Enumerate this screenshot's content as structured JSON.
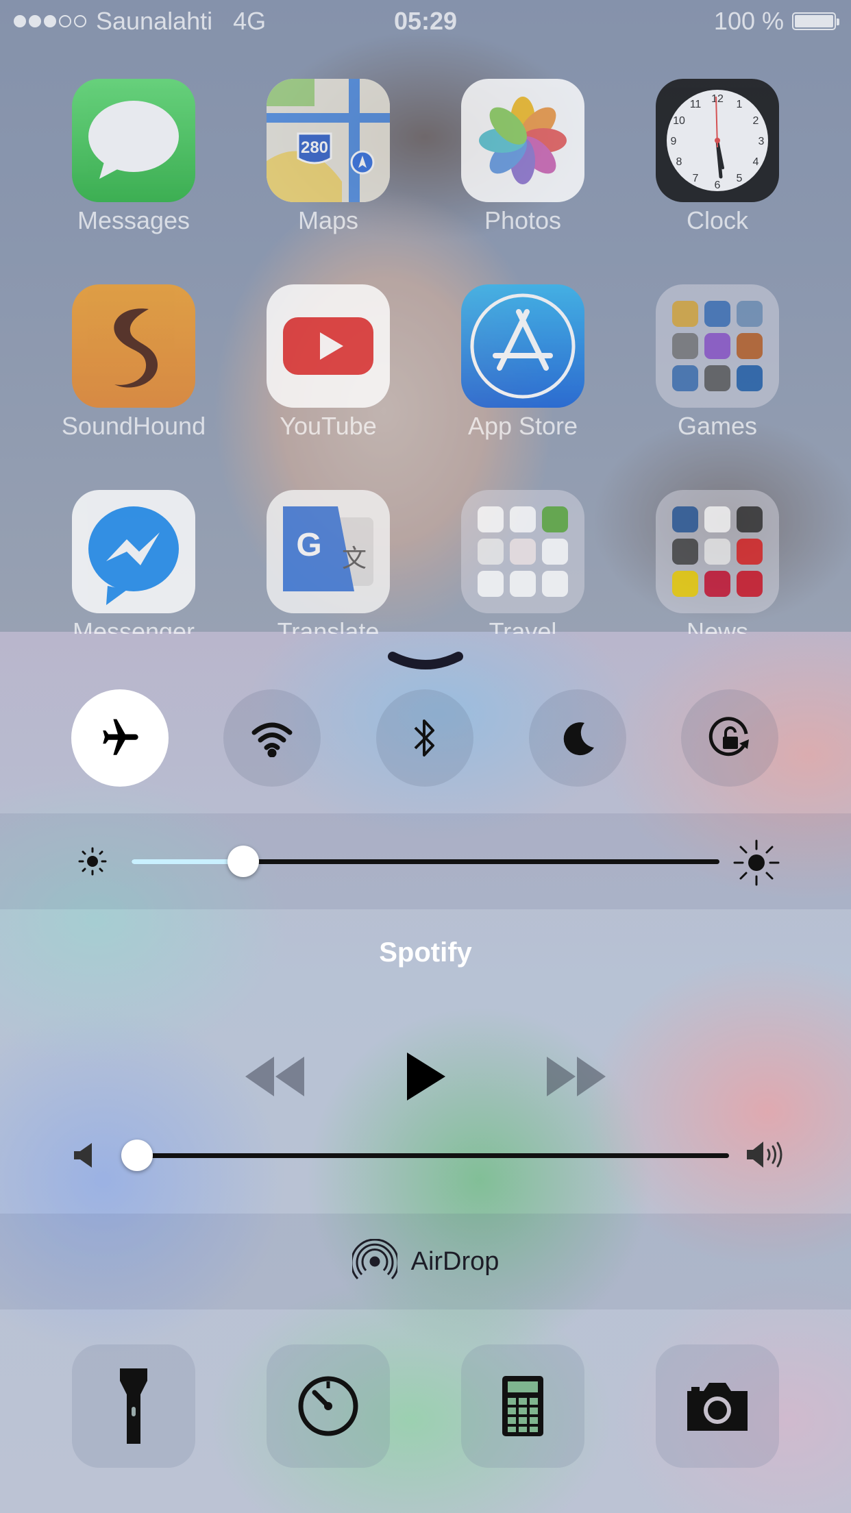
{
  "status_bar": {
    "carrier": "Saunalahti",
    "network": "4G",
    "time": "05:29",
    "battery": "100 %",
    "signal_bars_filled": 3,
    "signal_bars_total": 5
  },
  "home_apps": [
    {
      "label": "Messages"
    },
    {
      "label": "Maps",
      "badge": "280"
    },
    {
      "label": "Photos"
    },
    {
      "label": "Clock"
    },
    {
      "label": "SoundHound"
    },
    {
      "label": "YouTube"
    },
    {
      "label": "App Store"
    },
    {
      "label": "Games"
    },
    {
      "label": "Messenger"
    },
    {
      "label": "Translate"
    },
    {
      "label": "Travel"
    },
    {
      "label": "News"
    }
  ],
  "control_center": {
    "toggles": [
      {
        "name": "airplane-mode",
        "icon": "airplane-icon",
        "active": true
      },
      {
        "name": "wifi",
        "icon": "wifi-icon",
        "active": false
      },
      {
        "name": "bluetooth",
        "icon": "bluetooth-icon",
        "active": false
      },
      {
        "name": "do-not-disturb",
        "icon": "moon-icon",
        "active": false
      },
      {
        "name": "rotation-lock",
        "icon": "rotation-lock-icon",
        "active": false
      }
    ],
    "brightness_level": 0.19,
    "now_playing": {
      "app": "Spotify",
      "volume_level": 0.0
    },
    "airdrop": {
      "label": "AirDrop"
    },
    "quick_actions": [
      {
        "name": "flashlight",
        "icon": "flashlight-icon"
      },
      {
        "name": "timer",
        "icon": "timer-icon"
      },
      {
        "name": "calculator",
        "icon": "calculator-icon"
      },
      {
        "name": "camera",
        "icon": "camera-icon"
      }
    ],
    "accent_on": "#ffffff",
    "brightness_fill_color": "#c9f0ff"
  }
}
